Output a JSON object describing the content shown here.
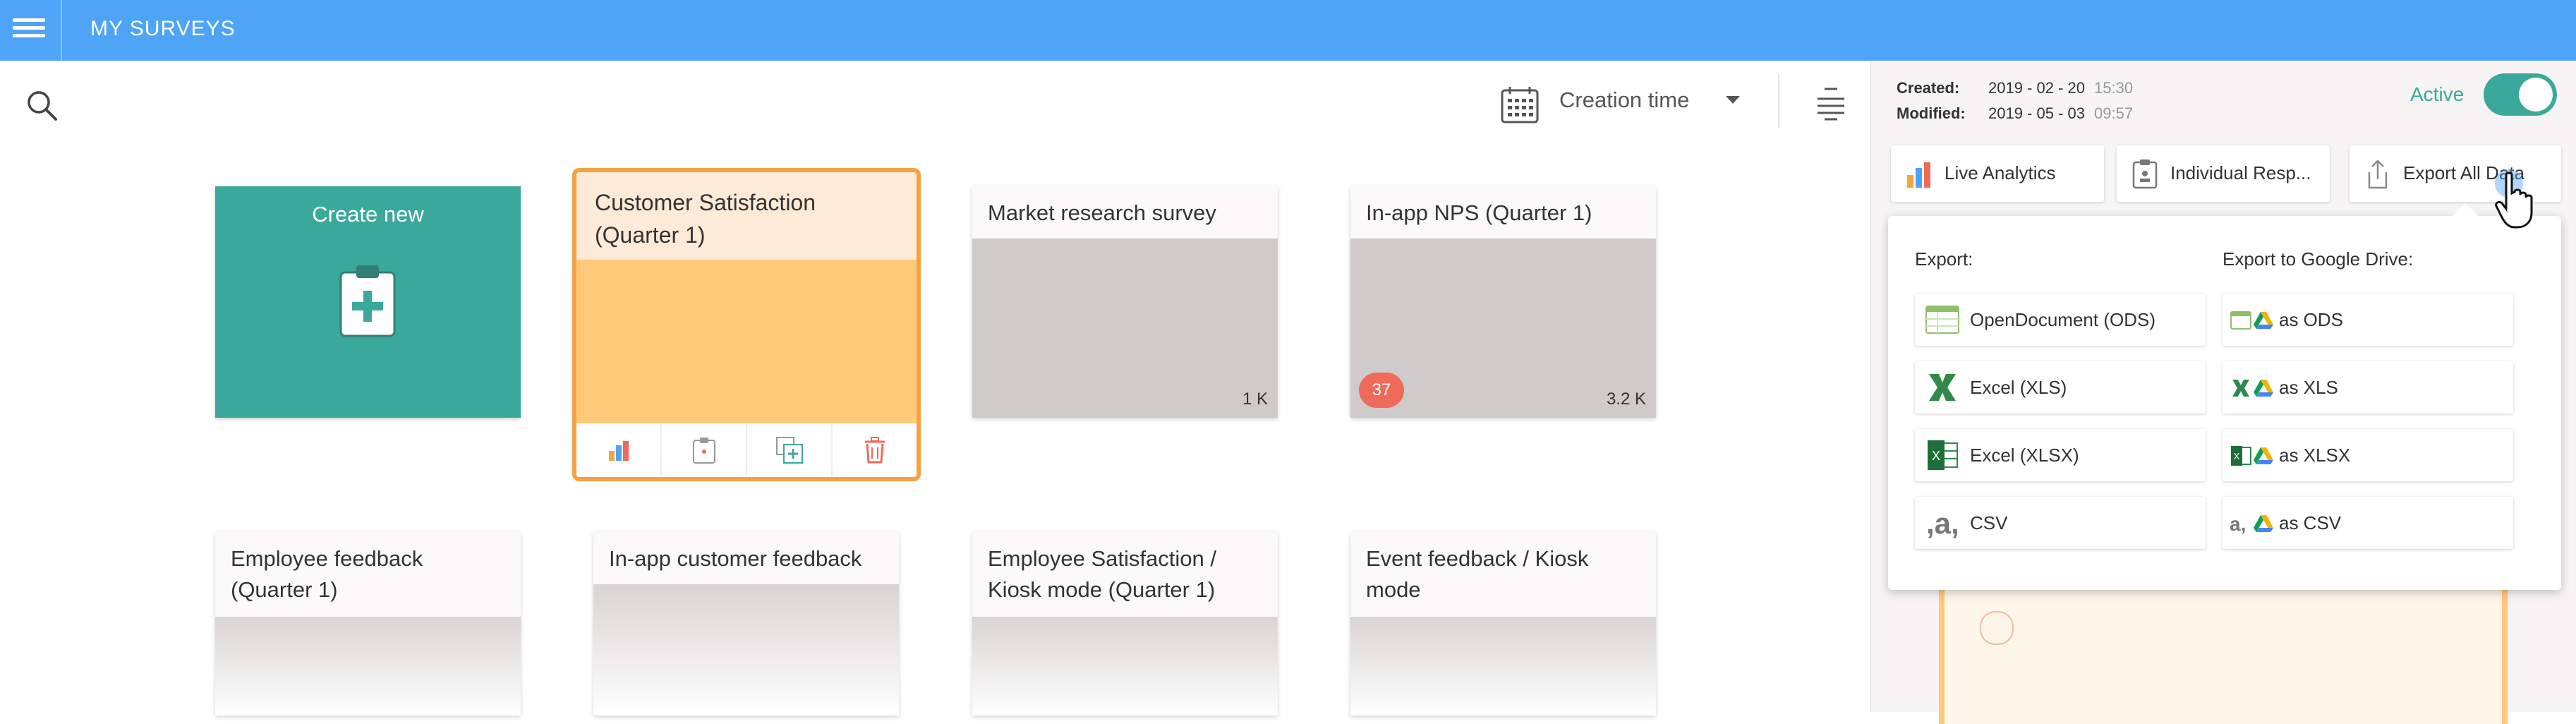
{
  "header": {
    "title": "MY SURVEYS"
  },
  "toolbar": {
    "sort_label": "Creation time"
  },
  "create_card": {
    "label": "Create new"
  },
  "surveys": [
    {
      "title": "Customer Satisfaction (Quarter 1)"
    },
    {
      "title": "Market research survey",
      "responses": "1 K"
    },
    {
      "title": "In-app NPS (Quarter 1)",
      "responses": "3.2 K",
      "badge": "37"
    },
    {
      "title": "Employee feedback (Quarter 1)"
    },
    {
      "title": "In-app customer feedback"
    },
    {
      "title": "Employee Satisfaction / Kiosk mode (Quarter 1)"
    },
    {
      "title": "Event feedback / Kiosk mode"
    }
  ],
  "details": {
    "created_label": "Created:",
    "created_date": "2019 - 02 - 20",
    "created_time": "15:30",
    "modified_label": "Modified:",
    "modified_date": "2019 - 05 - 03",
    "modified_time": "09:57",
    "active_label": "Active"
  },
  "detail_tabs": {
    "live_analytics": "Live Analytics",
    "individual": "Individual Resp...",
    "export_all": "Export All Data"
  },
  "export_menu": {
    "export_heading": "Export:",
    "drive_heading": "Export to Google Drive:",
    "export_options": [
      "OpenDocument (ODS)",
      "Excel (XLS)",
      "Excel (XLSX)",
      "CSV"
    ],
    "drive_options": [
      "as ODS",
      "as XLS",
      "as XLSX",
      "as CSV"
    ]
  },
  "colors": {
    "topbar": "#4ea4f6",
    "create_card": "#3aa99c",
    "selected_border": "#f5a342",
    "badge": "#ef6a5b"
  }
}
